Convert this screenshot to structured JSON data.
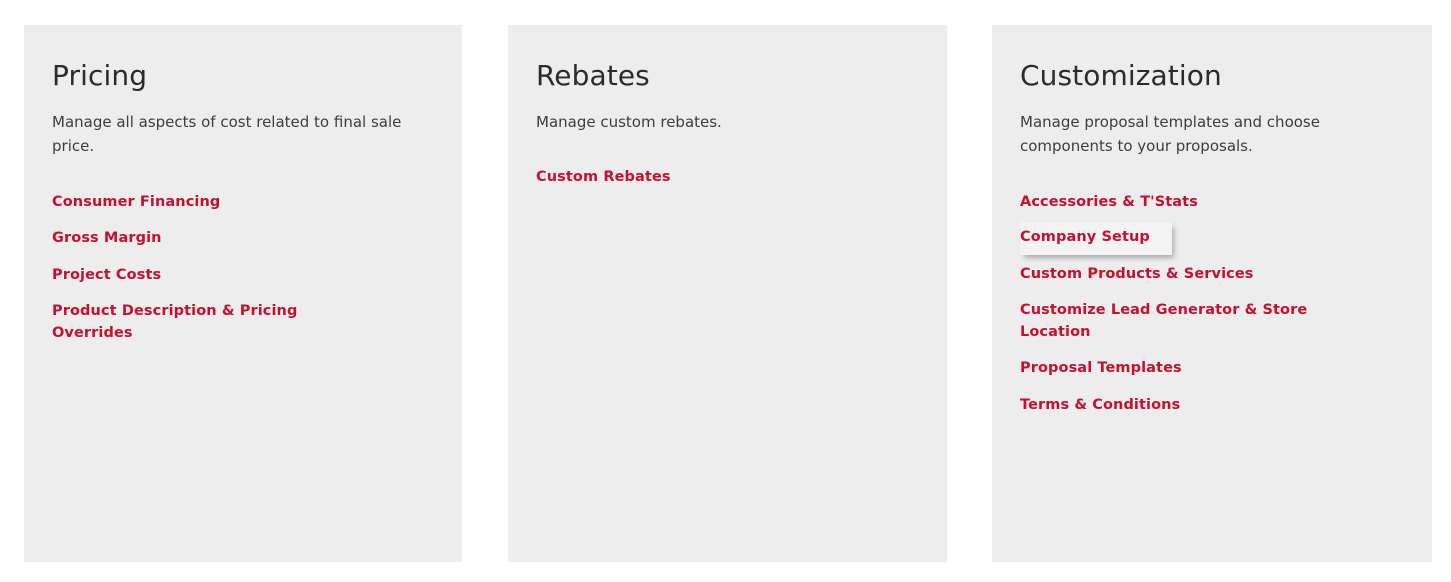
{
  "theme": {
    "page_background": "#ffffff",
    "card_background": "#ededed",
    "link_color": "#c8102e",
    "title_color": "#2b2b2b",
    "description_color": "#3d3d3d",
    "hover_panel_background": "#f3f3f3"
  },
  "cards": [
    {
      "id": "pricing",
      "title": "Pricing",
      "description": "Manage all aspects of cost related to final sale price.",
      "links": [
        {
          "label": "Consumer Financing",
          "hovered": false
        },
        {
          "label": "Gross Margin",
          "hovered": false
        },
        {
          "label": "Project Costs",
          "hovered": false
        },
        {
          "label": "Product Description & Pricing Overrides",
          "hovered": false
        }
      ]
    },
    {
      "id": "rebates",
      "title": "Rebates",
      "description": "Manage custom rebates.",
      "links": [
        {
          "label": "Custom Rebates",
          "hovered": false
        }
      ]
    },
    {
      "id": "customization",
      "title": "Customization",
      "description": "Manage proposal templates and choose components to your proposals.",
      "links": [
        {
          "label": "Accessories & T'Stats",
          "hovered": false
        },
        {
          "label": "Company Setup",
          "hovered": true
        },
        {
          "label": "Custom Products & Services",
          "hovered": false
        },
        {
          "label": "Customize Lead Generator & Store Location",
          "hovered": false
        },
        {
          "label": "Proposal Templates",
          "hovered": false
        },
        {
          "label": "Terms & Conditions",
          "hovered": false
        }
      ]
    }
  ]
}
